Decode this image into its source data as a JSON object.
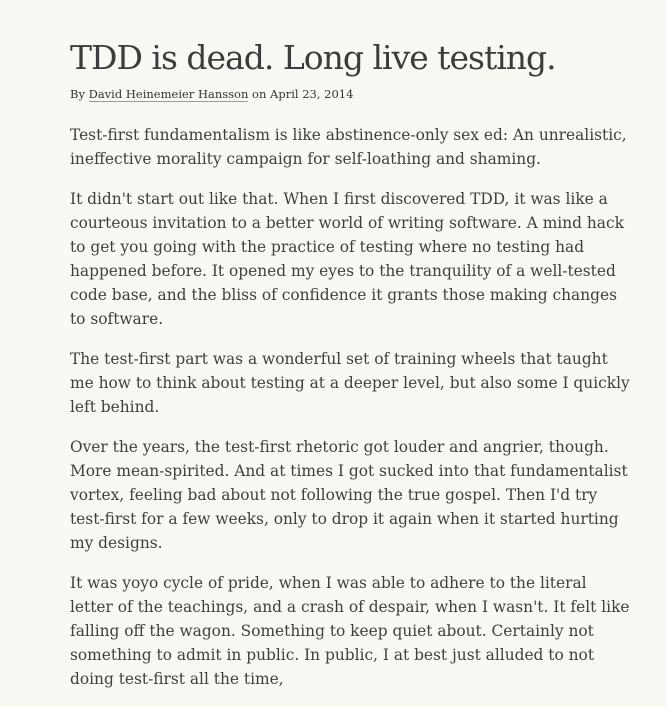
{
  "article": {
    "title": "TDD is dead. Long live testing.",
    "byline": {
      "prefix": "By",
      "author": "David Heinemeier Hansson",
      "date_prefix": "on",
      "date": "April 23, 2014"
    },
    "paragraphs": [
      "Test-first fundamentalism is like abstinence-only sex ed: An unrealistic, ineffective morality campaign for self-loathing and shaming.",
      "It didn't start out like that. When I first discovered TDD, it was like a courteous invitation to a better world of writing software. A mind hack to get you going with the practice of testing where no testing had happened before. It opened my eyes to the tranquility of a well-tested code base, and the bliss of confidence it grants those making changes to software.",
      "The test-first part was a wonderful set of training wheels that taught me how to think about testing at a deeper level, but also some I quickly left behind.",
      "Over the years, the test-first rhetoric got louder and angrier, though. More mean-spirited. And at times I got sucked into that fundamentalist vortex, feeling bad about not following the true gospel. Then I'd try test-first for a few weeks, only to drop it again when it started hurting my designs.",
      "It was yoyo cycle of pride, when I was able to adhere to the literal letter of the teachings, and a crash of despair, when I wasn't. It felt like falling off the wagon. Something to keep quiet about. Certainly not something to admit in public. In public, I at best just alluded to not doing test-first all the time,"
    ]
  }
}
